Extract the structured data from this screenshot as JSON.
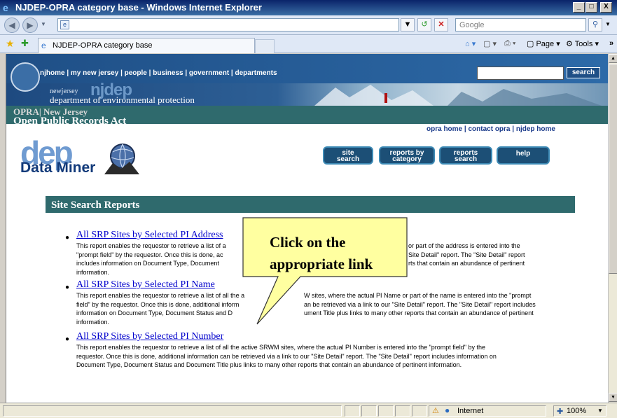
{
  "window": {
    "title": "NJDEP-OPRA category base - Windows Internet Explorer",
    "minimize": "_",
    "maximize": "□",
    "close": "X"
  },
  "addressbar": {
    "url": "",
    "search_placeholder": "Google"
  },
  "tabs": {
    "active_tab_label": "NJDEP-OPRA category base"
  },
  "toolbar": {
    "page_label": "Page",
    "tools_label": "Tools"
  },
  "site_header": {
    "nav_links": "njhome  |  my new jersey  |  people  |  business  |  government  |  departments",
    "search_button": "search",
    "newjersey": "newjersey",
    "njdep": "njdep",
    "department": "department of environmental protection",
    "opra_line1": "OPRA| New Jersey",
    "opra_line2": "Open Public Records Act"
  },
  "top_links": [
    "opra home",
    "contact opra",
    "njdep home"
  ],
  "logo": {
    "dep": "dep",
    "word": "Data Miner"
  },
  "nav_buttons": [
    {
      "line1": "site",
      "line2": "search"
    },
    {
      "line1": "reports by",
      "line2": "category"
    },
    {
      "line1": "reports",
      "line2": "search"
    },
    {
      "line1": "help",
      "line2": ""
    }
  ],
  "section": {
    "title": "Site Search Reports"
  },
  "reports": [
    {
      "title": "All SRP Sites by Selected PI Address",
      "desc": [
        "This report enables the requestor to retrieve a list of a",
        "\"prompt field\" by the requestor. Once this is done, ac",
        "includes information on Document Type, Document",
        "information."
      ],
      "desc_right": [
        "or part of the address is entered into the",
        "Site Detail\" report. The \"Site Detail\" report",
        "rts that contain an abundance of pertinent"
      ]
    },
    {
      "title": "All SRP Sites by Selected PI Name",
      "desc": [
        "This report enables the requestor to retrieve a list of all the a",
        "field\" by the requestor. Once this is done, additional inform",
        "information on Document Type, Document Status and D",
        "information."
      ],
      "desc_right": [
        "W sites, where the actual PI Name or part of the name is entered into the \"prompt",
        "an be retrieved via a link to our \"Site Detail\" report. The \"Site Detail\" report includes",
        "ument Title plus links to many other reports that contain an abundance of pertinent"
      ]
    },
    {
      "title": "All SRP Sites by Selected PI Number",
      "desc": [
        "This report enables the requestor to retrieve a list of all the active SRWM sites, where the actual PI Number is entered into the \"prompt field\" by the",
        "requestor. Once this is done, additional information can be retrieved via a link to our \"Site Detail\" report. The \"Site Detail\" report includes information on",
        "Document Type, Document Status and Document Title plus links to many other reports that contain an abundance of pertinent information."
      ],
      "desc_right": []
    }
  ],
  "callout": {
    "line1": "Click on the",
    "line2": "appropriate link"
  },
  "statusbar": {
    "zone": "Internet",
    "zoom": "100%"
  }
}
